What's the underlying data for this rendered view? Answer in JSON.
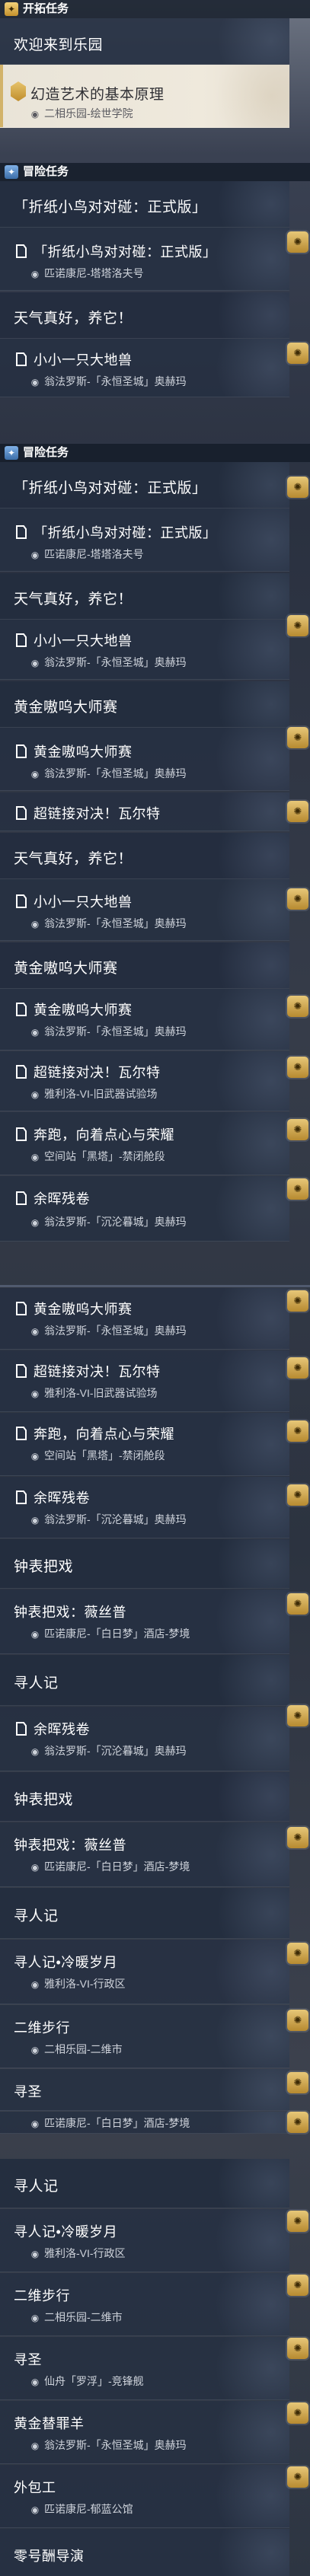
{
  "headers": {
    "pioneer": "开拓任务",
    "adventure": "冒险任务"
  },
  "pioneer": {
    "welcome": "欢迎来到乐园",
    "principle_title": "幻造艺术的基本原理",
    "principle_loc": "二相乐园-绘世学院"
  },
  "quests": {
    "origami": "「折纸小鸟对对碰：正式版」",
    "origami_loc": "匹诺康尼-塔塔洛夫号",
    "weather": "天气真好，养它！",
    "beast": "小小一只大地兽",
    "beast_loc": "翁法罗斯-「永恒圣城」奥赫玛",
    "gold_master": "黄金嗷呜大师赛",
    "gold_master_loc": "翁法罗斯-「永恒圣城」奥赫玛",
    "super": "超链接对决！瓦尔特",
    "super_loc": "雅利洛-VI-旧武器试验场",
    "run": "奔跑，向着点心与荣耀",
    "run_loc": "空间站「黑塔」-禁闭舱段",
    "remnant": "余晖残卷",
    "remnant_loc": "翁法罗斯-「沉沦暮城」奥赫玛",
    "clock": "钟表把戏",
    "clock_sub": "钟表把戏：薇丝普",
    "clock_loc": "匹诺康尼-「白日梦」酒店-梦境",
    "seeker": "寻人记",
    "seeker_sub": "寻人记•冷暖岁月",
    "seeker_loc": "雅利洛-VI-行政区",
    "dim_walk": "二维步行",
    "dim_walk_loc": "二相乐园-二维市",
    "search": "寻圣",
    "search_loc": "仙舟「罗浮」-竞锋舰",
    "clock_loc2": "匹诺康尼-「白日梦」酒店-梦境",
    "search_loc2": "仙舟「罗浮」-竞锋舰",
    "gold_goat": "黄金替罪羊",
    "gold_goat_loc": "翁法罗斯-「永恒圣城」奥赫玛",
    "courier": "外包工",
    "courier_loc": "匹诺康尼-郁蓝公馆",
    "zero": "零号酬导演"
  },
  "icons": {
    "header_pioneer": "pioneer-quest-icon",
    "header_adventure": "adventure-quest-icon",
    "reward": "reward-coin-icon",
    "pin": "location-pin-icon",
    "quest": "quest-marker-icon"
  },
  "colors": {
    "header_bg": "#1c2634",
    "reward_gold": "#d2a54a",
    "light_card": "#ebe5d9"
  }
}
